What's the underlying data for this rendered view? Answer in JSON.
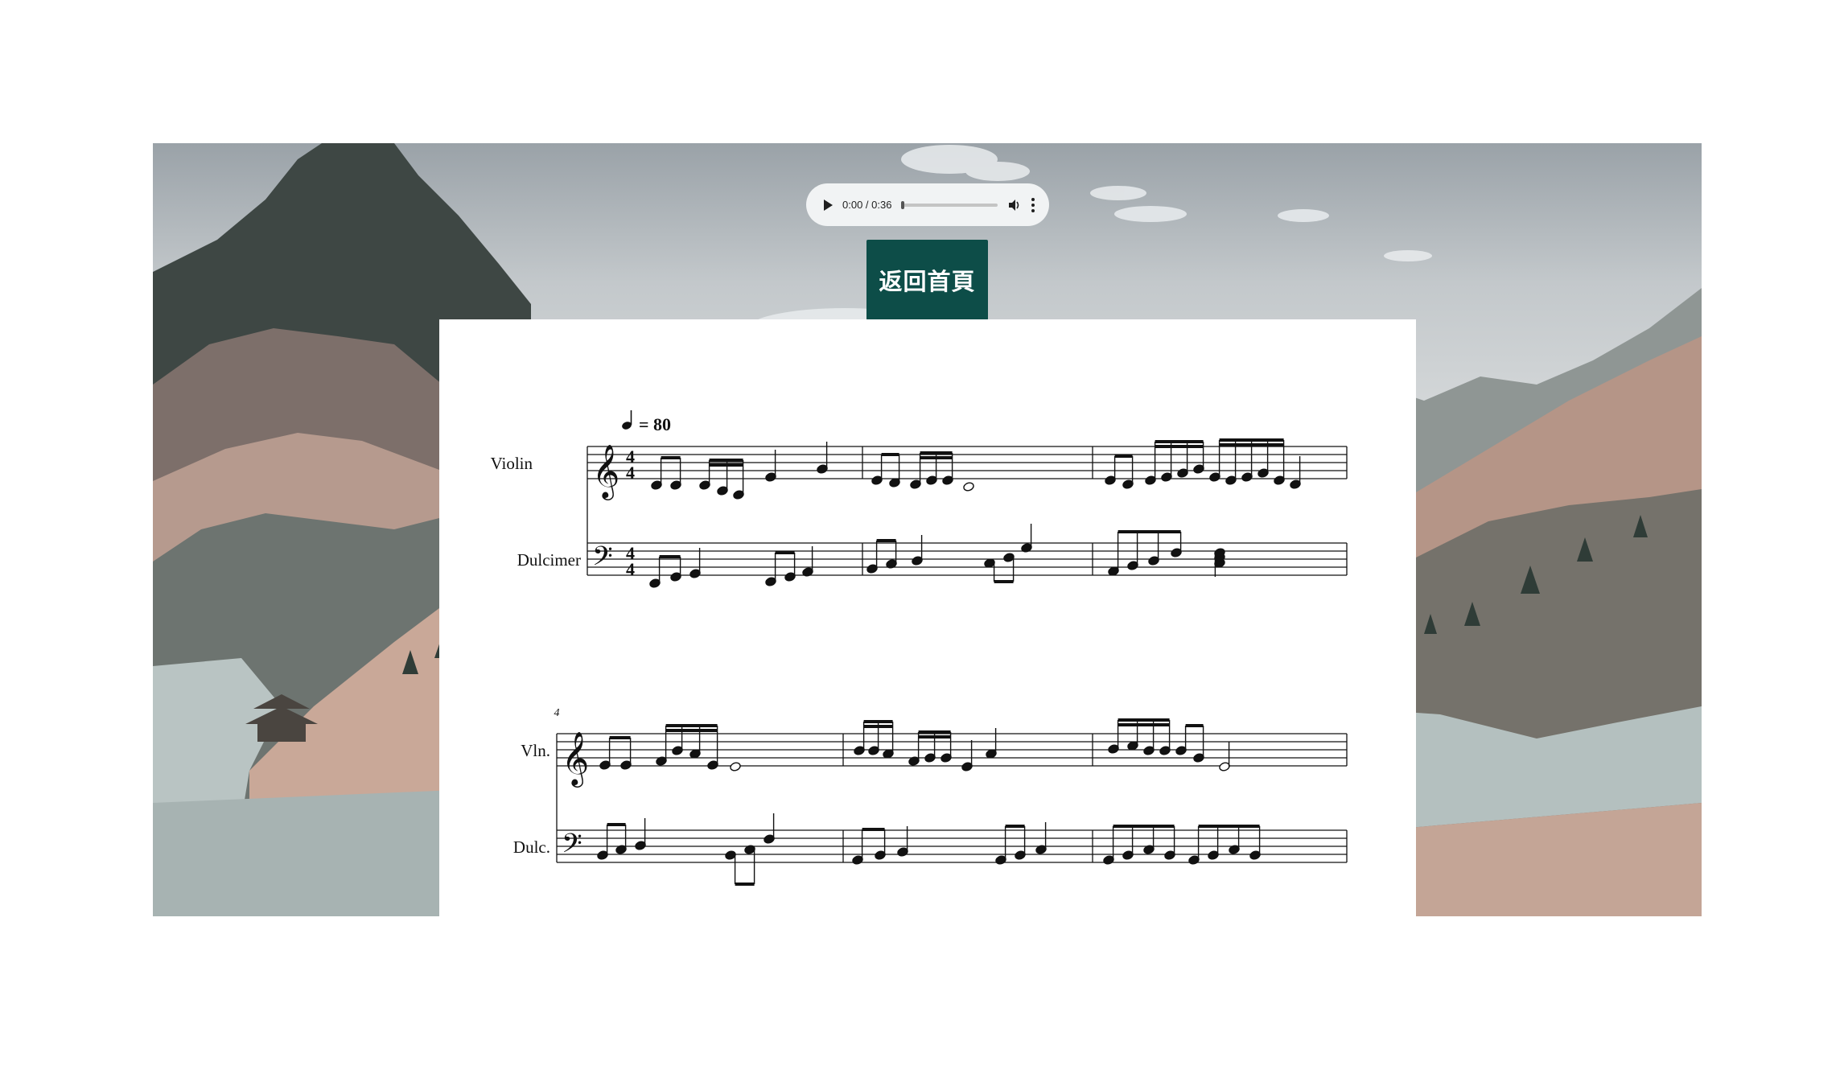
{
  "audio_player": {
    "time_display": "0:00 / 0:36",
    "progress_fraction": 0,
    "play_icon": "play-icon",
    "volume_icon": "volume-icon",
    "menu_icon": "more-vertical-icon"
  },
  "home_button": {
    "label": "返回首頁"
  },
  "score": {
    "tempo_mark": "= 80",
    "time_signature": "4/4",
    "system1": {
      "instrument_1": "Violin",
      "instrument_2": "Dulcimer"
    },
    "system2": {
      "bar_number": "4",
      "instrument_1": "Vln.",
      "instrument_2": "Dulc."
    }
  },
  "colors": {
    "button_bg": "#0d4d48",
    "player_bg": "#f1f3f4"
  }
}
